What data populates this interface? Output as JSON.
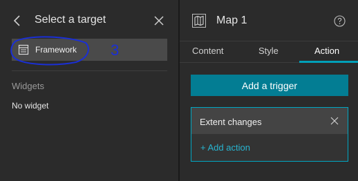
{
  "left_panel": {
    "title": "Select a target",
    "framework_label": "Framework",
    "widgets_heading": "Widgets",
    "no_widget_text": "No widget",
    "annotation_text": "3"
  },
  "right_panel": {
    "title": "Map 1",
    "tabs": [
      {
        "label": "Content",
        "active": false
      },
      {
        "label": "Style",
        "active": false
      },
      {
        "label": "Action",
        "active": true
      }
    ],
    "add_trigger_label": "Add a trigger",
    "trigger": {
      "title": "Extent changes",
      "add_action_label": "+ Add action"
    }
  },
  "icons": {
    "back": "chevron-left-icon",
    "close": "close-icon",
    "framework": "layout-icon",
    "map": "map-icon",
    "help": "help-icon"
  },
  "colors": {
    "accent": "#037d93",
    "accent_highlight": "#00a0b8",
    "link": "#28b4d0",
    "annotation": "#1a2fd6",
    "panel_bg": "#2b2b2b"
  }
}
